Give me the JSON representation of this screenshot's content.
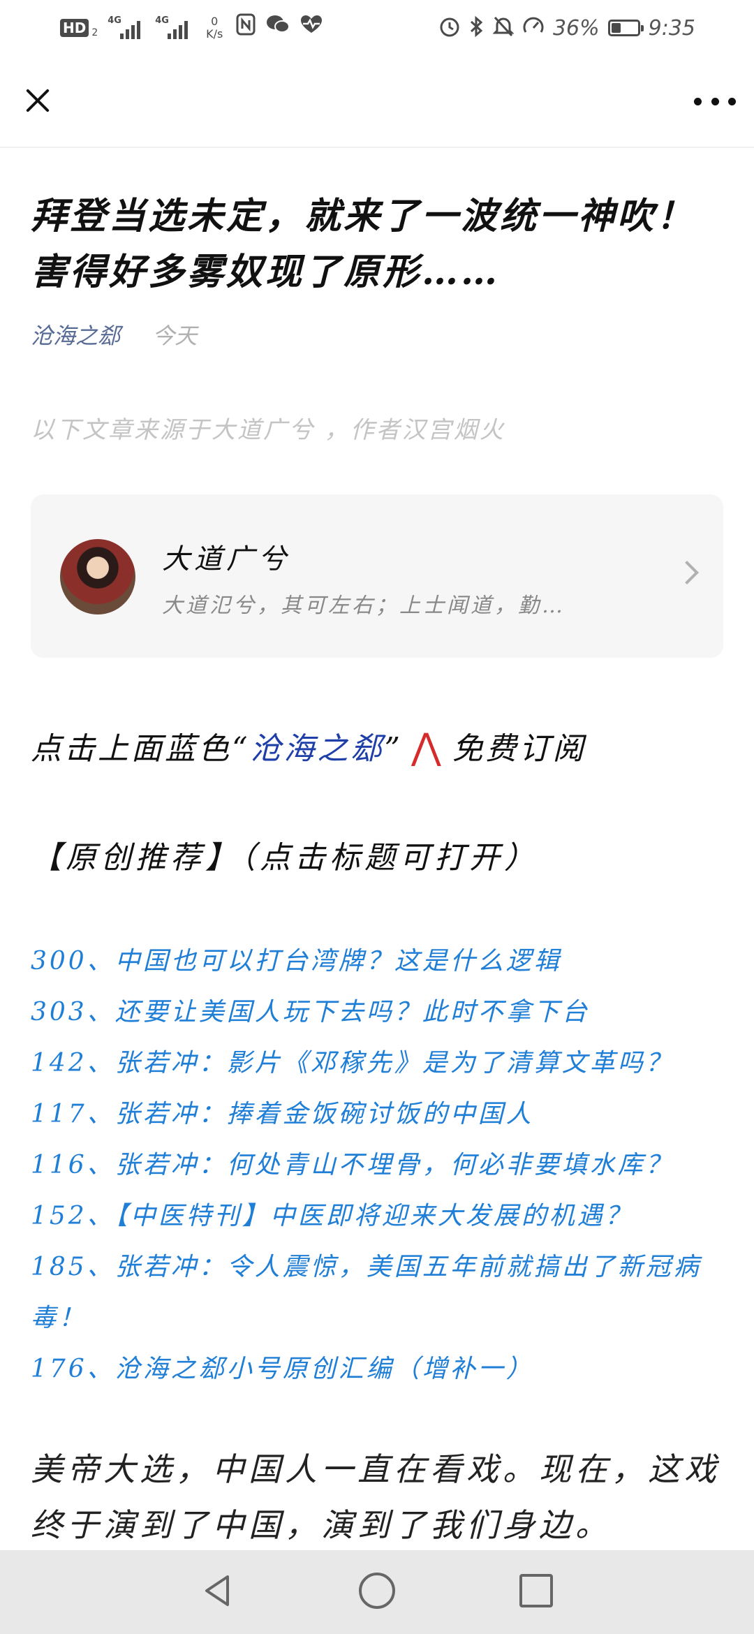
{
  "status_bar": {
    "hd": "HD",
    "hd_sub": "2",
    "signal1_tag": "4G",
    "signal2_tag": "4G",
    "net_speed_value": "0",
    "net_speed_unit": "K/s",
    "battery_percent": "36%",
    "battery_level": 0.36,
    "time": "9:35",
    "icons_left": [
      "nfc-icon",
      "wechat-icon",
      "health-icon"
    ],
    "icons_right": [
      "alarm-icon",
      "bluetooth-icon",
      "mute-icon",
      "speed-gauge-icon"
    ]
  },
  "navbar": {
    "close_icon": "close-icon",
    "more_icon": "more-icon"
  },
  "article": {
    "title": "拜登当选未定，就来了一波统一神吹！害得好多雾奴现了原形……",
    "author": "沧海之郄",
    "date": "今天",
    "source_note": "以下文章来源于大道广兮 ，作者汉宫烟火"
  },
  "profile_card": {
    "name": "大道广兮",
    "description": "大道氾兮，其可左右；上士闻道，勤…"
  },
  "subscribe": {
    "prefix": "点击上面蓝色“",
    "account": "沧海之郄",
    "suffix": "”",
    "caret": "⋀",
    "action": "免费订阅"
  },
  "recommend": {
    "heading": "【原创推荐】（点击标题可打开）",
    "links": [
      "300、中国也可以打台湾牌？这是什么逻辑",
      "303、还要让美国人玩下去吗？此时不拿下台",
      "142、张若冲：影片《邓稼先》是为了清算文革吗？",
      "117、张若冲：捧着金饭碗讨饭的中国人",
      "116、张若冲：何处青山不埋骨，何必非要填水库？",
      "152、【中医特刊】中医即将迎来大发展的机遇？",
      "185、张若冲：令人震惊，美国五年前就搞出了新冠病毒！",
      "176、沧海之郄小号原创汇编（增补一）"
    ]
  },
  "body": {
    "paragraph": "美帝大选，中国人一直在看戏。现在，这戏终于演到了中国，演到了我们身边。"
  },
  "bottom_nav": {
    "back_icon": "back-icon",
    "home_icon": "home-icon",
    "recent_icon": "recent-apps-icon"
  }
}
